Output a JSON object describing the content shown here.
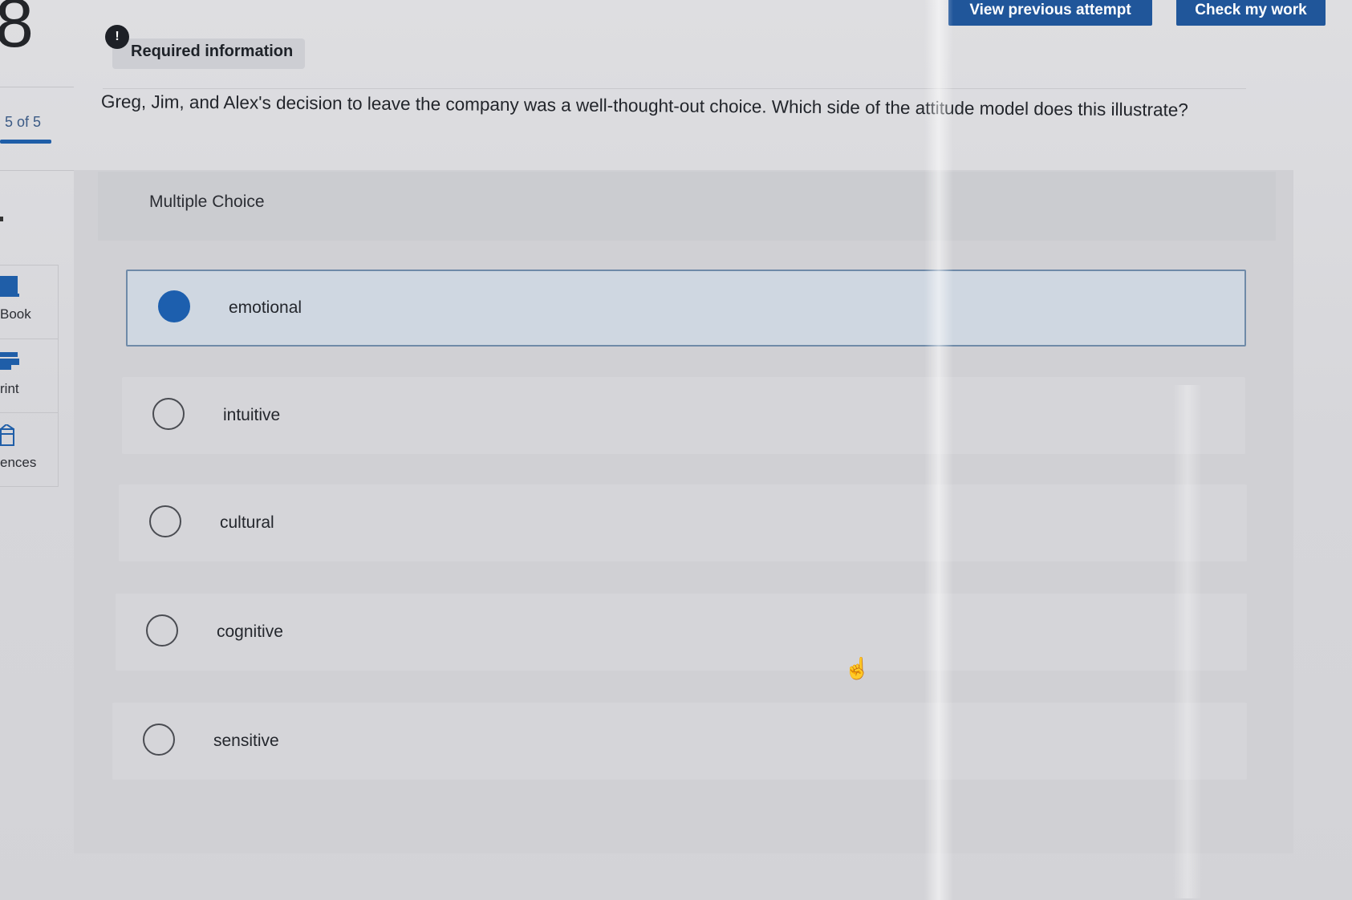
{
  "question_number": "8",
  "progress": {
    "label": "5 of 5",
    "current": 5,
    "total": 5
  },
  "sidebar": {
    "items": [
      {
        "label": "Book",
        "icon": "book-icon"
      },
      {
        "label": "rint",
        "icon": "print-icon"
      },
      {
        "label": "ences",
        "icon": "references-icon"
      }
    ]
  },
  "toolbar": {
    "view_previous_label": "View previous attempt",
    "check_work_label": "Check my work"
  },
  "required_info": {
    "label": "Required information",
    "icon": "exclamation-icon"
  },
  "question_text": "Greg, Jim, and Alex's decision to leave the company was a well-thought-out choice. Which side of the attitude model does this illustrate?",
  "multiple_choice": {
    "heading": "Multiple Choice",
    "selected_index": 0,
    "options": [
      {
        "label": "emotional"
      },
      {
        "label": "intuitive"
      },
      {
        "label": "cultural"
      },
      {
        "label": "cognitive"
      },
      {
        "label": "sensitive"
      }
    ]
  },
  "colors": {
    "accent": "#20569a",
    "selected_radio": "#1d5fae",
    "selected_bg": "#cfd7e1"
  }
}
